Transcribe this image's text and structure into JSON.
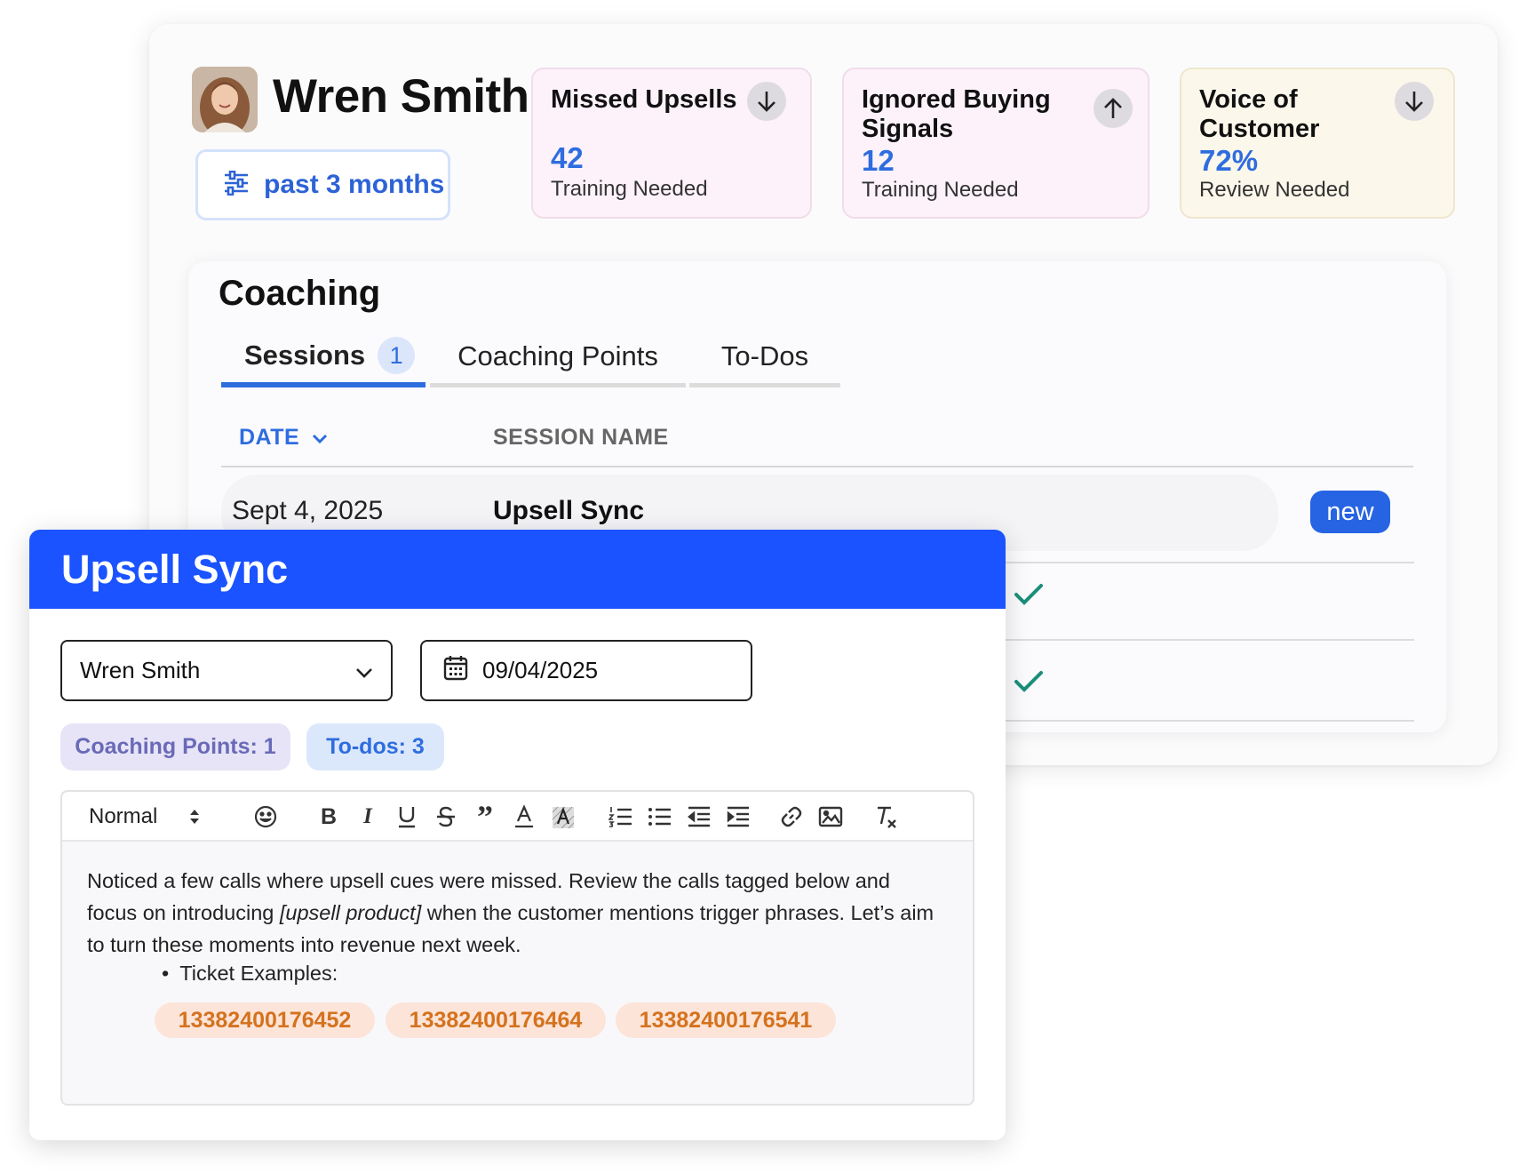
{
  "profile": {
    "name": "Wren Smith",
    "period_label": "past 3 months"
  },
  "stats": [
    {
      "title": "Missed Upsells",
      "value": "42",
      "sub": "Training Needed",
      "trend": "down"
    },
    {
      "title": "Ignored Buying Signals",
      "value": "12",
      "sub": "Training Needed",
      "trend": "up"
    },
    {
      "title": "Voice of Customer",
      "value": "72%",
      "sub": "Review Needed",
      "trend": "down"
    }
  ],
  "coaching": {
    "title": "Coaching",
    "tabs": [
      {
        "label": "Sessions",
        "badge": "1",
        "active": true
      },
      {
        "label": "Coaching Points"
      },
      {
        "label": "To-Dos"
      }
    ],
    "columns": {
      "date": "DATE",
      "session_name": "SESSION NAME"
    },
    "rows": [
      {
        "date": "Sept 4, 2025",
        "name": "Upsell Sync",
        "badge": "new"
      }
    ]
  },
  "modal": {
    "title": "Upsell Sync",
    "person_select": "Wren Smith",
    "date_value": "09/04/2025",
    "pills": {
      "coaching_points": "Coaching Points: 1",
      "todos": "To-dos: 3"
    },
    "toolbar": {
      "format": "Normal"
    },
    "body": {
      "text_before": "Noticed a few calls where upsell cues were missed. Review the calls tagged below and focus on introducing ",
      "text_italic": "[upsell product]",
      "text_after": " when the customer mentions trigger phrases. Let’s aim to turn these moments into revenue next week.",
      "bullet": "Ticket Examples:",
      "tickets": [
        "13382400176452",
        "13382400176464",
        "13382400176541"
      ]
    }
  },
  "colors": {
    "accent": "#2f6ddf",
    "modal_header": "#1a53ff",
    "check": "#1a8f7a",
    "ticket_text": "#d4721e",
    "ticket_bg": "#fde4d8"
  }
}
